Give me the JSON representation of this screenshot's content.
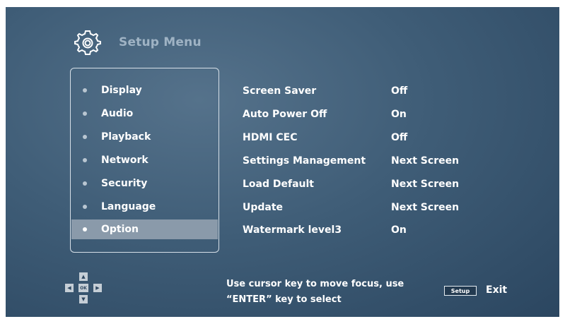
{
  "header": {
    "title": "Setup Menu",
    "icon": "gear-icon"
  },
  "sidebar": {
    "selected_index": 6,
    "items": [
      {
        "label": "Display"
      },
      {
        "label": "Audio"
      },
      {
        "label": "Playback"
      },
      {
        "label": "Network"
      },
      {
        "label": "Security"
      },
      {
        "label": "Language"
      },
      {
        "label": "Option"
      }
    ]
  },
  "options": [
    {
      "label": "Screen Saver",
      "value": "Off"
    },
    {
      "label": "Auto Power Off",
      "value": "On"
    },
    {
      "label": "HDMI CEC",
      "value": "Off"
    },
    {
      "label": "Settings Management",
      "value": "Next Screen"
    },
    {
      "label": "Load Default",
      "value": "Next Screen"
    },
    {
      "label": "Update",
      "value": "Next Screen"
    },
    {
      "label": "Watermark level3",
      "value": "On"
    }
  ],
  "footer": {
    "dpad": {
      "up": "▲",
      "down": "▼",
      "left": "◀",
      "right": "▶",
      "ok": "OK"
    },
    "hint_line1": "Use cursor key to move focus, use",
    "hint_line2": "“ENTER” key to select",
    "setup_key": "Setup",
    "exit_label": "Exit"
  },
  "colors": {
    "background": "#3f5d77",
    "selected_row": "#8a9aaa",
    "text": "#ffffff",
    "title": "#9fb3c4"
  }
}
